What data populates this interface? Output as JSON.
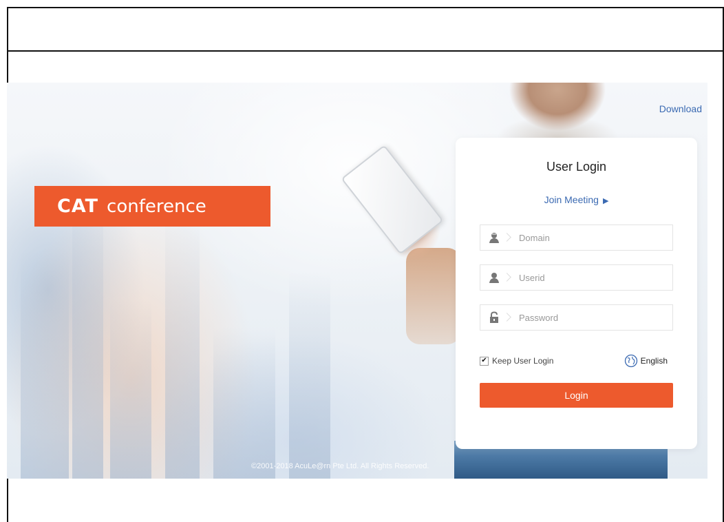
{
  "brand": {
    "mark": "CAT",
    "word": "conference",
    "accent": "#ed5a2d"
  },
  "header": {
    "download_label": "Download"
  },
  "login": {
    "title": "User Login",
    "join_meeting_label": "Join Meeting",
    "fields": {
      "domain": {
        "placeholder": "Domain",
        "value": "",
        "icon": "building-person-icon"
      },
      "userid": {
        "placeholder": "Userid",
        "value": "",
        "icon": "user-icon"
      },
      "password": {
        "placeholder": "Password",
        "value": "",
        "icon": "lock-icon"
      }
    },
    "keep_login": {
      "label": "Keep User Login",
      "checked": true
    },
    "language": {
      "label": "English",
      "icon": "globe-icon"
    },
    "submit_label": "Login",
    "link_color": "#3b6ab2"
  },
  "footer": {
    "copyright": "©2001-2018 AcuLe@rn Pte Ltd. All Rights Reserved."
  }
}
